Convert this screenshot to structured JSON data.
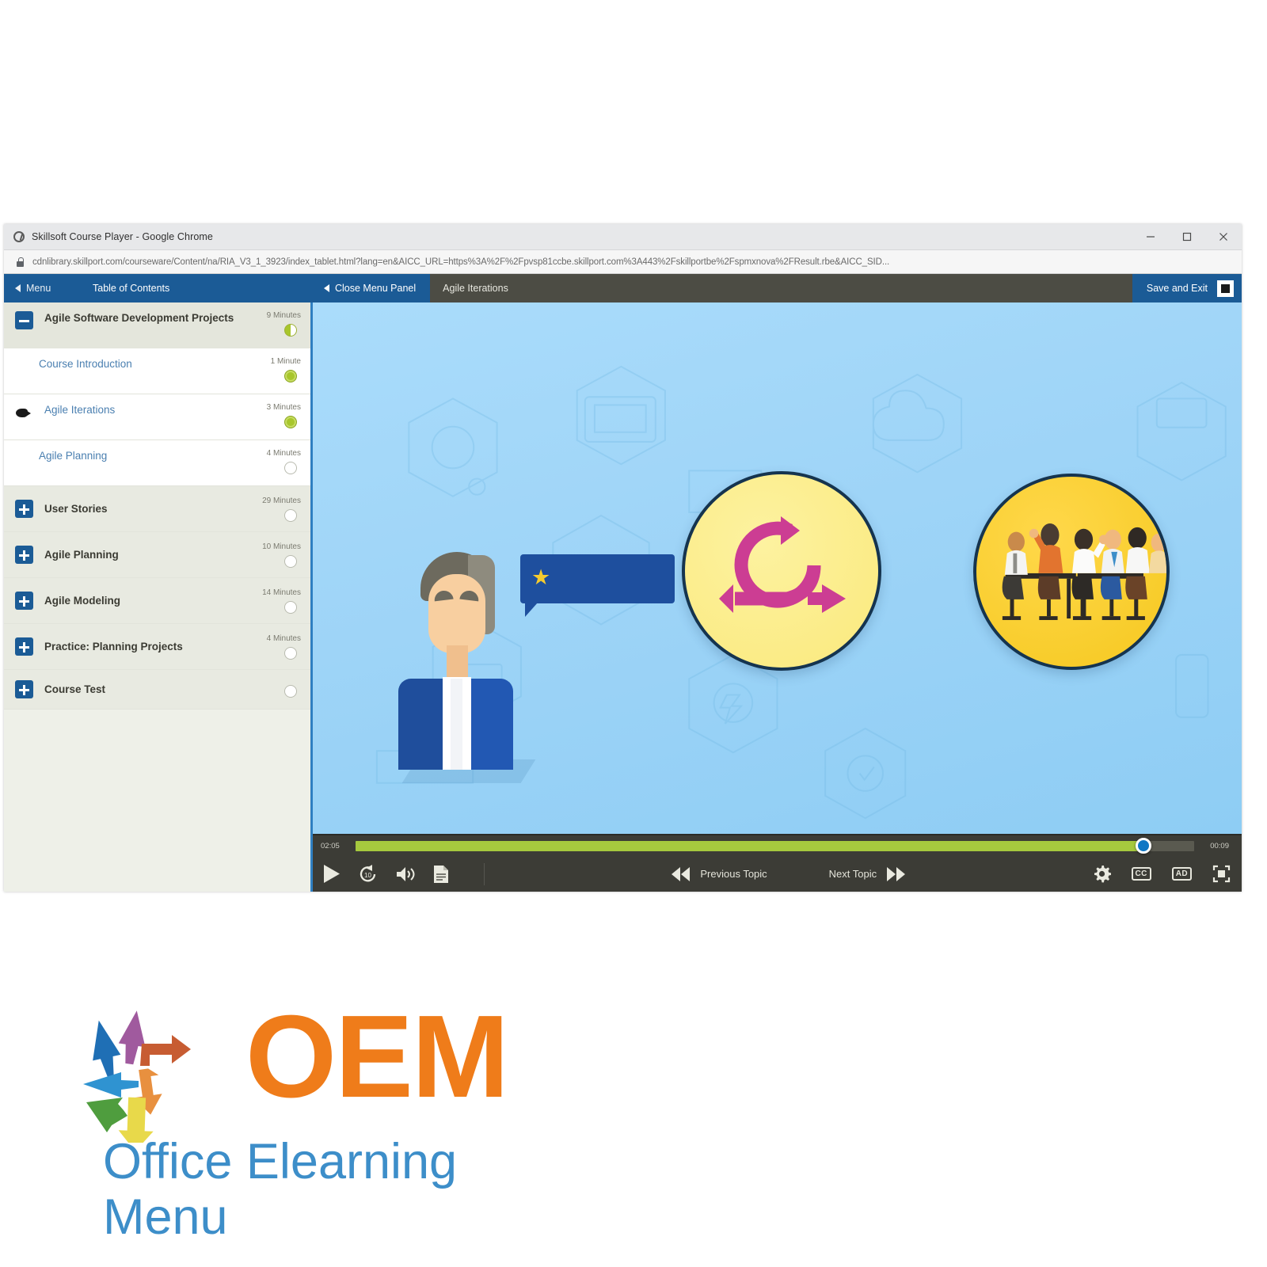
{
  "window": {
    "title": "Skillsoft Course Player - Google Chrome",
    "favicon": "skillsoft-globe-icon",
    "minimize_label": "minimize-icon",
    "maximize_label": "maximize-icon",
    "close_label": "close-icon",
    "url": "cdnlibrary.skillport.com/courseware/Content/na/RIA_V3_1_3923/index_tablet.html?lang=en&AICC_URL=https%3A%2F%2Fpvsp81ccbe.skillport.com%3A443%2Fskillportbe%2Fspmxnova%2FResult.rbe&AICC_SID..."
  },
  "topnav": {
    "menu_label": "Menu",
    "toc_label": "Table of Contents",
    "close_panel_label": "Close Menu Panel",
    "current_topic": "Agile Iterations",
    "save_exit_label": "Save and Exit",
    "exit_icon": "exit-icon"
  },
  "sidebar": {
    "items": [
      {
        "label": "Agile Software Development Projects",
        "duration": "9 Minutes",
        "type": "root",
        "icon": "collapse-minus-icon",
        "status": "partial"
      },
      {
        "label": "Course Introduction",
        "duration": "1 Minute",
        "type": "child",
        "icon": "none",
        "status": "done"
      },
      {
        "label": "Agile Iterations",
        "duration": "3 Minutes",
        "type": "child-current",
        "icon": "current-pointer-icon",
        "status": "done"
      },
      {
        "label": "Agile Planning",
        "duration": "4 Minutes",
        "type": "child",
        "icon": "none",
        "status": "empty"
      },
      {
        "label": "User Stories",
        "duration": "29 Minutes",
        "type": "group",
        "icon": "expand-plus-icon",
        "status": "empty"
      },
      {
        "label": "Agile Planning",
        "duration": "10 Minutes",
        "type": "group",
        "icon": "expand-plus-icon",
        "status": "empty"
      },
      {
        "label": "Agile Modeling",
        "duration": "14 Minutes",
        "type": "group",
        "icon": "expand-plus-icon",
        "status": "empty"
      },
      {
        "label": "Practice: Planning Projects",
        "duration": "4 Minutes",
        "type": "group",
        "icon": "expand-plus-icon",
        "status": "empty"
      },
      {
        "label": "Course Test",
        "duration": "",
        "type": "group",
        "icon": "expand-plus-icon",
        "status": "empty"
      }
    ]
  },
  "slide": {
    "description": "Agile iterations slide illustration",
    "person": "businessman-avatar",
    "speech_bubble_icon": "star-icon",
    "circle_one": "agile-iteration-loop-icon",
    "circle_two": "team-meeting-icon",
    "colors": {
      "background": "#9fd3f5",
      "bubble": "#1e4f9e",
      "star": "#f5cb2e",
      "loop": "#cc3d93",
      "circle_one_fill": "#fae97c",
      "circle_two_fill": "#f5c81f"
    }
  },
  "player": {
    "elapsed": "02:05",
    "remaining": "00:09",
    "progress_percent": 94,
    "play_label": "play-icon",
    "replay_label": "replay-10-icon",
    "volume_label": "volume-icon",
    "transcript_label": "transcript-icon",
    "previous_topic_label": "Previous Topic",
    "next_topic_label": "Next Topic",
    "settings_label": "gear-icon",
    "cc_label": "CC",
    "ad_label": "AD",
    "fullscreen_label": "fullscreen-icon"
  },
  "logo": {
    "wordmark": "OEM",
    "tagline": "Office Elearning Menu",
    "arrow_colors": [
      "#1f6fb5",
      "#a05a9e",
      "#c75c32",
      "#2f93d1",
      "#e8903f",
      "#4f9d3e",
      "#e8d94a"
    ],
    "wordmark_color": "#ef7c1a",
    "tagline_color": "#3d8ec9"
  }
}
